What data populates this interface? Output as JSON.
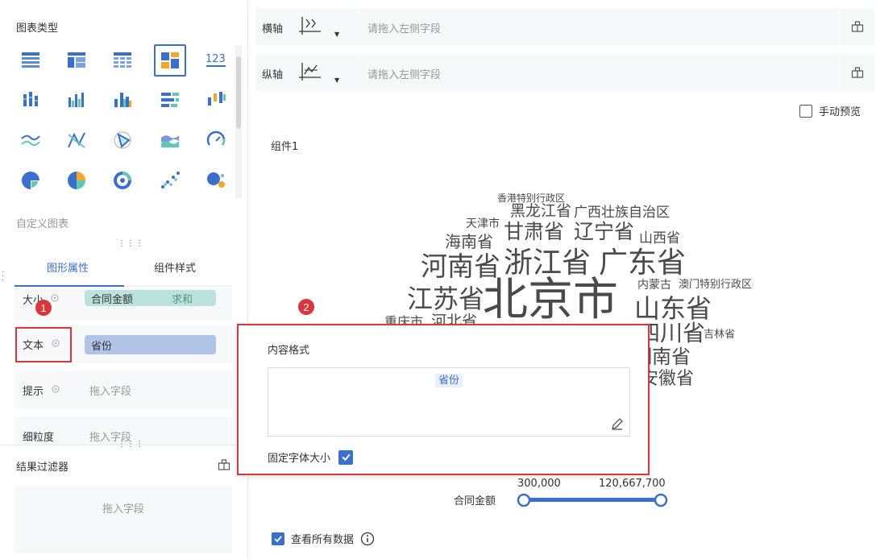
{
  "left": {
    "chart_type_title": "图表类型",
    "custom_chart": "自定义图表",
    "tabs": {
      "graph_props": "图形属性",
      "component_style": "组件样式"
    },
    "props": {
      "size": {
        "label": "大小",
        "pill_field": "合同金额",
        "pill_agg": "求和"
      },
      "text": {
        "label": "文本",
        "pill_field": "省份"
      },
      "tip": {
        "label": "提示",
        "placeholder": "拖入字段"
      },
      "granularity": {
        "label": "细粒度",
        "placeholder": "拖入字段"
      }
    },
    "filter": {
      "title": "结果过滤器",
      "placeholder": "拖入字段"
    }
  },
  "chart_type_icons": [
    "table-icon",
    "cross-table-icon",
    "detail-table-icon",
    "grouped-table-icon",
    "kpi-number-icon",
    "column-chart-icon",
    "grouped-column-icon",
    "stacked-column-icon",
    "bar-chart-icon",
    "range-column-icon",
    "line-chart-icon",
    "radar-line-icon",
    "radar-area-icon",
    "area-chart-icon",
    "gauge-icon",
    "pie-chart-icon",
    "multi-pie-icon",
    "ring-pie-icon",
    "scatter-icon",
    "bubble-icon"
  ],
  "axes": {
    "x": {
      "label": "横轴",
      "placeholder": "请拖入左侧字段"
    },
    "y": {
      "label": "纵轴",
      "placeholder": "请拖入左侧字段"
    }
  },
  "manual_preview": "手动预览",
  "component_name": "组件1",
  "wordcloud": [
    "香港特别行政区",
    "黑龙江省",
    "广西壮族自治区",
    "天津市",
    "甘肃省",
    "辽宁省",
    "山西省",
    "海南省",
    "河南省",
    "浙江省",
    "广东省",
    "内蒙古",
    "澳门特别行政区",
    "江苏省",
    "北京市",
    "山东省",
    "重庆市",
    "河北省",
    "四川省",
    "吉林省",
    "湖南省",
    "安徽省"
  ],
  "legend": {
    "field": "合同金额",
    "min": "300,000",
    "max": "120,667,700"
  },
  "view_all_data": "查看所有数据",
  "popup": {
    "title": "内容格式",
    "token": "省份",
    "fixed_font": "固定字体大小"
  },
  "callouts": {
    "one": "1",
    "two": "2"
  },
  "colors": {
    "accent": "#3a6fcf",
    "callout": "#d9363e",
    "size_pill": "#b9e3dc",
    "text_pill": "#b0c4e8"
  }
}
